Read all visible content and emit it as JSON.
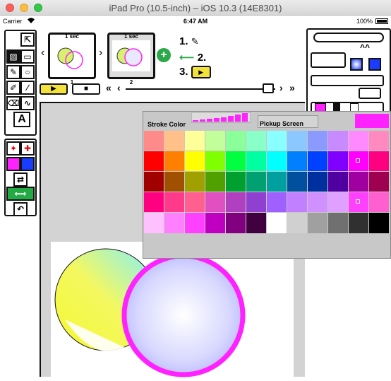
{
  "window": {
    "title": "iPad Pro (10.5-inch) – iOS 10.3 (14E8301)"
  },
  "status_bar": {
    "carrier": "Carrier",
    "time": "6:47 AM",
    "battery": "100%"
  },
  "left_toolbar": {
    "tools": [
      {
        "name": "select-arrow-icon",
        "glyph": "⇱"
      },
      {
        "name": "fill-tool-icon",
        "glyph": "▨"
      },
      {
        "name": "rect-tool-icon",
        "glyph": "▭"
      },
      {
        "name": "pencil-tool-icon",
        "glyph": "✎"
      },
      {
        "name": "ellipse-tool-icon",
        "glyph": "○"
      },
      {
        "name": "brush-tool-icon",
        "glyph": "✐"
      },
      {
        "name": "line-tool-icon",
        "glyph": "∕"
      },
      {
        "name": "text-tool-icon",
        "glyph": "A"
      }
    ]
  },
  "frames": [
    {
      "label": "1 sec",
      "number": "1"
    },
    {
      "label": "1 sec",
      "number": "2"
    }
  ],
  "instructions": {
    "step1": "1.",
    "step2": "2.",
    "step3": "3."
  },
  "color_picker": {
    "stroke_label": "Stroke Color",
    "pickup_label": "Pickup Screen",
    "current_color": "#ff22ff",
    "rows": [
      [
        "#ff8a8a",
        "#ffc08a",
        "#ffff9a",
        "#c2ff9a",
        "#8aff9a",
        "#8affc8",
        "#8affff",
        "#8ac8ff",
        "#8a9aff",
        "#c88aff",
        "#ff8aff",
        "#ff8ac0"
      ],
      [
        "#ff0000",
        "#ff8000",
        "#ffff00",
        "#80ff00",
        "#00ff40",
        "#00ffa0",
        "#00ffff",
        "#0080ff",
        "#0040ff",
        "#8000ff",
        "#ff00ff",
        "#ff0080"
      ],
      [
        "#a00000",
        "#a05000",
        "#a0a000",
        "#50a000",
        "#00a030",
        "#00a070",
        "#00a0a0",
        "#0050a0",
        "#0030a0",
        "#5000a0",
        "#a000a0",
        "#a00050"
      ],
      [
        "#ff0080",
        "#ff3a8a",
        "#ff6090",
        "#e050c0",
        "#b040c0",
        "#9040d0",
        "#a060ff",
        "#c080ff",
        "#d090ff",
        "#e0a0ff",
        "#ff40ff",
        "#ff60d0"
      ],
      [
        "#ffc0ff",
        "#ff80ff",
        "#ff40ff",
        "#c000c0",
        "#800080",
        "#400040",
        "#ffffff",
        "#d0d0d0",
        "#a0a0a0",
        "#707070",
        "#303030",
        "#000000"
      ]
    ]
  }
}
